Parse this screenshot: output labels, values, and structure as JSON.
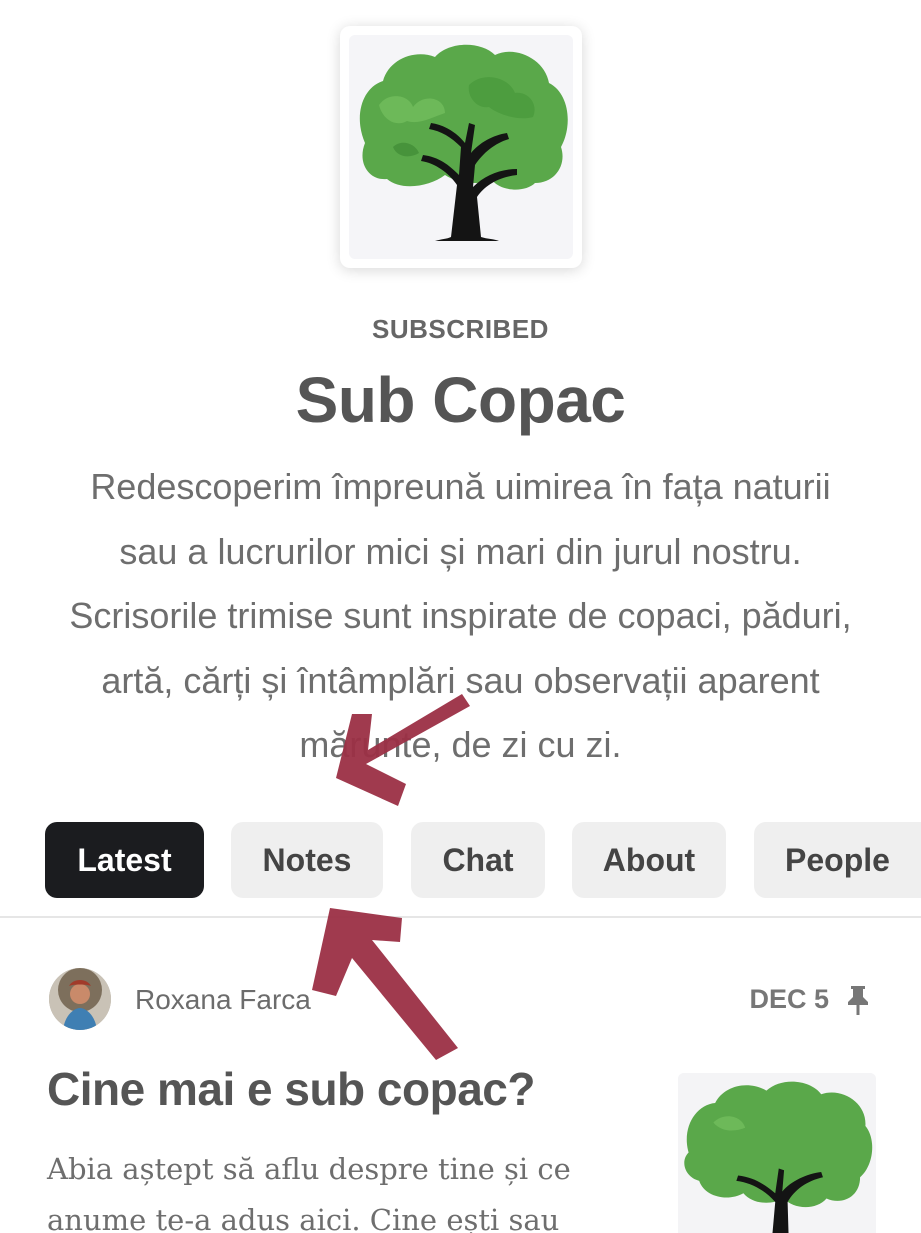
{
  "publication": {
    "status_label": "SUBSCRIBED",
    "title": "Sub Copac",
    "description": "Redescoperim împreună uimirea în fața naturii sau a lucrurilor mici și mari din jurul nostru. Scrisorile trimise sunt inspirate de copaci, păduri, artă, cărți și întâmplări sau observații aparent mărunte, de zi cu zi."
  },
  "tabs": [
    {
      "label": "Latest",
      "active": true
    },
    {
      "label": "Notes",
      "active": false
    },
    {
      "label": "Chat",
      "active": false
    },
    {
      "label": "About",
      "active": false
    },
    {
      "label": "People",
      "active": false
    }
  ],
  "post": {
    "author": "Roxana Farca",
    "date": "DEC 5",
    "pinned": true,
    "title": "Cine mai e sub copac?",
    "excerpt": "Abia aștept să aflu despre tine și ce anume te-a adus aici. Cine ești sau"
  },
  "colors": {
    "active_tab_bg": "#1b1c1f",
    "tab_bg": "#efefef",
    "arrow": "#9b2f45",
    "tree_canopy": "#5aa84a"
  },
  "icons": {
    "pin": "pin-icon",
    "logo": "tree-logo-icon"
  }
}
